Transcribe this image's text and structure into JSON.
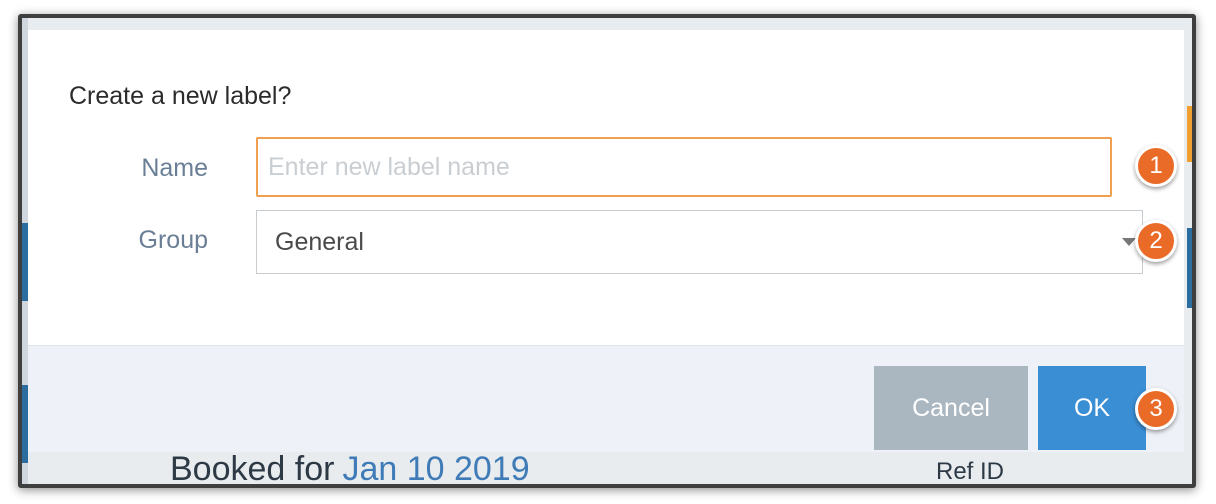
{
  "background": {
    "booked_prefix": "Booked for",
    "booked_date": "Jan 10 2019",
    "ref_label": "Ref ID"
  },
  "dialog": {
    "title": "Create a new label?",
    "name_label": "Name",
    "name_placeholder": "Enter new label name",
    "name_value": "",
    "group_label": "Group",
    "group_value": "General",
    "cancel_label": "Cancel",
    "ok_label": "OK"
  },
  "callouts": [
    "1",
    "2",
    "3"
  ],
  "colors": {
    "accent": "#3a8ed4",
    "callout": "#ea6a27",
    "input_focus_border": "#f0a050",
    "cancel": "#aab7c1"
  },
  "icons": {
    "group_dropdown": "chevron-down-icon"
  }
}
